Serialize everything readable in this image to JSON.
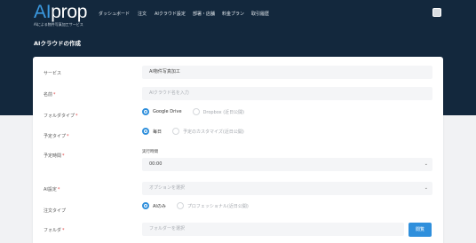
{
  "brand": {
    "logo_ai": "AI",
    "logo_rest": "prop",
    "tagline": "AIによる物件写真加工サービス"
  },
  "nav": {
    "items": [
      {
        "label": "ダッシュボード"
      },
      {
        "label": "注文"
      },
      {
        "label": "AIクラウド設定"
      },
      {
        "label": "部署・店舗"
      },
      {
        "label": "料金プラン"
      },
      {
        "label": "取引履歴"
      }
    ]
  },
  "page": {
    "title": "AIクラウドの作成"
  },
  "form": {
    "service": {
      "label": "サービス",
      "value": "AI物件写真加工"
    },
    "name": {
      "label": "名前",
      "required": "*",
      "placeholder": "AIクラウド名を入力"
    },
    "folder_type": {
      "label": "フォルダタイプ",
      "required": "*",
      "options": [
        {
          "label": "Google Drive",
          "selected": true
        },
        {
          "label": "Dropbox (近日公開)",
          "selected": false
        }
      ]
    },
    "schedule_type": {
      "label": "予定タイプ",
      "required": "*",
      "options": [
        {
          "label": "毎日",
          "selected": true
        },
        {
          "label": "予定のカスタマイズ(近日公開)",
          "selected": false
        }
      ]
    },
    "schedule_time": {
      "label": "予定時間",
      "required": "*",
      "sublabel": "実行時間",
      "value": "00:00"
    },
    "ai_setting": {
      "label": "AI設定",
      "required": "*",
      "placeholder": "オプションを選択"
    },
    "order_type": {
      "label": "注文タイプ",
      "options": [
        {
          "label": "AIのみ",
          "selected": true
        },
        {
          "label": "プロフェッショナル(近日公開)",
          "selected": false
        }
      ]
    },
    "folder": {
      "label": "フォルダ",
      "required": "*",
      "placeholder": "フォルダーを選択",
      "button": "閲覧"
    }
  },
  "colors": {
    "header_bg": "#13283d",
    "accent": "#2f8fdc",
    "required": "#e04848"
  }
}
